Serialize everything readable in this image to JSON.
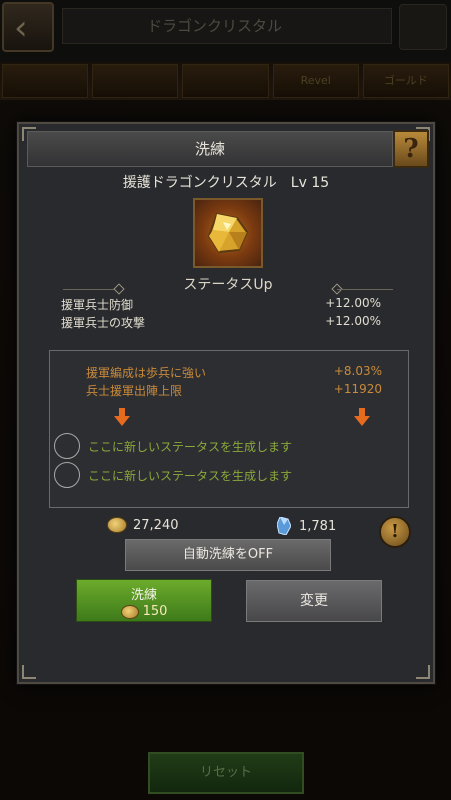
{
  "background": {
    "title": "ドラゴンクリスタル",
    "tabs": [
      "",
      "",
      "",
      "Revel",
      "ゴールド"
    ],
    "bottom_button": "リセット"
  },
  "dialog": {
    "title": "洗練",
    "help_symbol": "?",
    "item_name": "援護ドラゴンクリスタル　Lv 15",
    "status_header": "ステータスUp",
    "stats": [
      {
        "name": "援軍兵士防御",
        "value": "+12.00%"
      },
      {
        "name": "援軍兵士の攻撃",
        "value": "+12.00%"
      }
    ],
    "reroll": {
      "current": [
        {
          "name": "援軍編成は歩兵に強い",
          "value": "+8.03%"
        },
        {
          "name": "兵士援軍出陣上限",
          "value": "+11920"
        }
      ],
      "new_slots": [
        {
          "text": "ここに新しいステータスを生成します"
        },
        {
          "text": "ここに新しいステータスを生成します"
        }
      ]
    },
    "currency": {
      "gold": "27,240",
      "crystal": "1,781"
    },
    "info_symbol": "!",
    "auto_refine_label": "自動洗練をOFF",
    "refine_button": {
      "label": "洗練",
      "cost": "150"
    },
    "change_button": "変更"
  }
}
